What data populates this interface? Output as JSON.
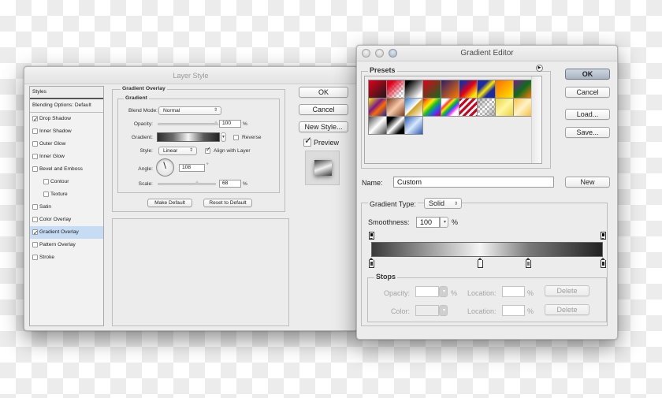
{
  "layer_style": {
    "title": "Layer Style",
    "styles_list": {
      "header": "Styles",
      "blending": "Blending Options: Default",
      "items": [
        {
          "label": "Drop Shadow",
          "checked": true,
          "indent": false,
          "selected": false
        },
        {
          "label": "Inner Shadow",
          "checked": false,
          "indent": false,
          "selected": false
        },
        {
          "label": "Outer Glow",
          "checked": false,
          "indent": false,
          "selected": false
        },
        {
          "label": "Inner Glow",
          "checked": false,
          "indent": false,
          "selected": false
        },
        {
          "label": "Bevel and Emboss",
          "checked": false,
          "indent": false,
          "selected": false
        },
        {
          "label": "Contour",
          "checked": false,
          "indent": true,
          "selected": false
        },
        {
          "label": "Texture",
          "checked": false,
          "indent": true,
          "selected": false
        },
        {
          "label": "Satin",
          "checked": false,
          "indent": false,
          "selected": false
        },
        {
          "label": "Color Overlay",
          "checked": false,
          "indent": false,
          "selected": false
        },
        {
          "label": "Gradient Overlay",
          "checked": true,
          "indent": false,
          "selected": true
        },
        {
          "label": "Pattern Overlay",
          "checked": false,
          "indent": false,
          "selected": false
        },
        {
          "label": "Stroke",
          "checked": false,
          "indent": false,
          "selected": false
        }
      ]
    },
    "panel": {
      "section_title": "Gradient Overlay",
      "group_title": "Gradient",
      "blend_mode_label": "Blend Mode:",
      "blend_mode_value": "Normal",
      "opacity_label": "Opacity:",
      "opacity_value": "100",
      "opacity_percent": 100,
      "opacity_unit": "%",
      "gradient_label": "Gradient:",
      "reverse_label": "Reverse",
      "reverse_checked": false,
      "style_label": "Style:",
      "style_value": "Linear",
      "align_label": "Align with Layer",
      "align_checked": true,
      "angle_label": "Angle:",
      "angle_value": "108",
      "angle_unit": "°",
      "scale_label": "Scale:",
      "scale_value": "68",
      "scale_percent": 68,
      "scale_unit": "%",
      "make_default": "Make Default",
      "reset_default": "Reset to Default"
    },
    "buttons": {
      "ok": "OK",
      "cancel": "Cancel",
      "new_style": "New Style...",
      "preview_label": "Preview",
      "preview_checked": true
    }
  },
  "gradient_editor": {
    "title": "Gradient Editor",
    "presets_label": "Presets",
    "presets": [
      "linear-gradient(135deg,#e0001a,#1a1a1a)",
      "linear-gradient(135deg,#e0001a 20%,rgba(255,255,255,0) 80%),repeating-conic-gradient(#ccc 0 25%,#fff 0 50%) 0 0/6px 6px",
      "linear-gradient(135deg,#000 15%,#fff 85%)",
      "linear-gradient(135deg,#e0001a,#0f6b1e)",
      "linear-gradient(135deg,#2a1a6a,#ff7a00)",
      "linear-gradient(135deg,#1a2aa0 15%,#e0001a 50%,#ffe800 85%)",
      "linear-gradient(135deg,#1a2aa0 30%,#ffe800 50%,#1a2aa0 70%)",
      "linear-gradient(135deg,#ff6a00,#ffe800)",
      "linear-gradient(135deg,#7a1a8a,#0f6b1e 50%,#ff7a00)",
      "linear-gradient(135deg,#ffe800,#7a1a8a 40%,#ff6a00 60%,#1a2aa0)",
      "linear-gradient(135deg,#7a3a1a,#f7c8a8 50%,#7a3a1a)",
      "linear-gradient(135deg,#2a7ad0,#fff 48%,#d0a020 52%,#fff)",
      "linear-gradient(135deg,#e0001a,#ff8a00,#ffe800,#1ac01a,#1a6ae0,#7a1ae0,#e0001a)",
      "linear-gradient(135deg,#fff 20%,#ff3a3a,#ffe800,#1ac01a,#1a6ae0,#ff3aff,#fff 80%)",
      "repeating-linear-gradient(135deg,#d0001a 0 3px,#fff 3px 6px)",
      "linear-gradient(135deg,rgba(120,120,120,0.6),rgba(255,255,255,0) 50%,rgba(120,120,120,0.6)),repeating-conic-gradient(#bbb 0 25%,#fff 0 50%) 0 0/6px 6px",
      "linear-gradient(135deg,#e8d23a,#fff6a0 50%,#e8d23a)",
      "linear-gradient(135deg,#f5c040,#fff3c8 50%,#f5c040)",
      "linear-gradient(135deg,#4a4a4a,#fff 50%,#4a4a4a)",
      "linear-gradient(135deg,#000 20%,#fff 50%,#000 80%)",
      "linear-gradient(135deg,#2a5ab0,#d8e8ff 50%,#2a5ab0)"
    ],
    "buttons": {
      "ok": "OK",
      "cancel": "Cancel",
      "load": "Load...",
      "save": "Save...",
      "new": "New"
    },
    "name_label": "Name:",
    "name_value": "Custom",
    "gradient_type_label": "Gradient Type:",
    "gradient_type_value": "Solid",
    "smoothness_label": "Smoothness:",
    "smoothness_value": "100",
    "smoothness_unit": "%",
    "opacity_stops": [
      {
        "location": 0,
        "opacity": 100
      },
      {
        "location": 100,
        "opacity": 100
      }
    ],
    "color_stops": [
      {
        "location": 0,
        "color": "#3a3a3a"
      },
      {
        "location": 47,
        "color": "#f5f5f5"
      },
      {
        "location": 68,
        "color": "#7a7a7a"
      },
      {
        "location": 100,
        "color": "#222222"
      }
    ],
    "stops": {
      "title": "Stops",
      "opacity_label": "Opacity:",
      "opacity_unit": "%",
      "location_label": "Location:",
      "location_unit": "%",
      "color_label": "Color:",
      "delete": "Delete"
    }
  }
}
